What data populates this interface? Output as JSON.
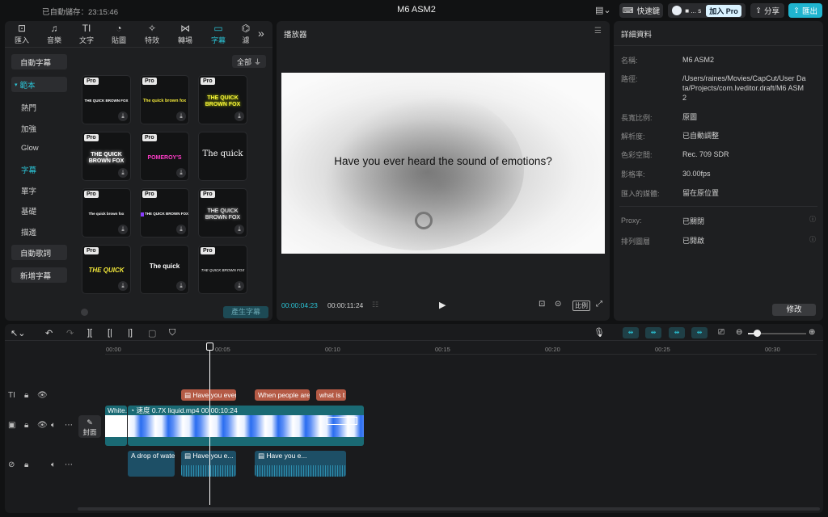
{
  "topbar": {
    "autosave": "已自動儲存：23:15:46",
    "title": "M6 ASM2",
    "shortcuts": "快速鍵",
    "account": "■ ... s",
    "pro": "加入 Pro",
    "share": "分享",
    "export": "匯出"
  },
  "tools": [
    "匯入",
    "音樂",
    "文字",
    "貼圖",
    "特效",
    "轉場",
    "字幕",
    "濾"
  ],
  "left": {
    "auto_caption": "自動字幕",
    "template_section": "範本",
    "items": [
      "熱門",
      "加強",
      "Glow",
      "字幕",
      "單字",
      "基礎",
      "描邊"
    ],
    "auto_lyrics": "自動歌詞",
    "add_caption": "新增字幕",
    "filter_label": "全部",
    "generate": "產生字幕",
    "cards": [
      {
        "text": "THE QUICK BROWN FOX",
        "pro": "Pro"
      },
      {
        "text": "The quick brown fox",
        "pro": "Pro"
      },
      {
        "text": "THE QUICK BROWN FOX",
        "pro": "Pro"
      },
      {
        "text": "THE QUICK BROWN FOX",
        "pro": "Pro"
      },
      {
        "text": "POMEROY'S",
        "pro": "Pro"
      },
      {
        "text": "The quick",
        "pro": ""
      },
      {
        "text": "The quick brown fox",
        "pro": "Pro"
      },
      {
        "text": "THE QUICK BROWN FOX",
        "pro": "Pro"
      },
      {
        "text": "THE QUICK BROWN FOX",
        "pro": "Pro"
      },
      {
        "text": "THE QUICK",
        "pro": "Pro"
      },
      {
        "text": "The quick",
        "pro": ""
      },
      {
        "text": "THE QUICK BROWN FOX",
        "pro": "Pro"
      }
    ]
  },
  "player": {
    "title": "播放器",
    "caption": "Have you ever heard the sound of emotions?",
    "current_time": "00:00:04:23",
    "total_time": "00:00:11:24",
    "ratio": "比例"
  },
  "details": {
    "title": "詳細資料",
    "rows": [
      {
        "label": "名稱:",
        "value": "M6 ASM2"
      },
      {
        "label": "路徑:",
        "value": "/Users/raines/Movies/CapCut/User Data/Projects/com.lveditor.draft/M6 ASM2"
      },
      {
        "label": "長寬比例:",
        "value": "原圖"
      },
      {
        "label": "解析度:",
        "value": "已自動調整"
      },
      {
        "label": "色彩空間:",
        "value": "Rec. 709 SDR"
      },
      {
        "label": "影格率:",
        "value": "30.00fps"
      },
      {
        "label": "匯入的媒體:",
        "value": "留在原位置"
      },
      {
        "label": "Proxy:",
        "value": "已關閉"
      },
      {
        "label": "排列圖層",
        "value": "已開啟"
      }
    ],
    "modify": "修改"
  },
  "timeline": {
    "ticks": [
      "00:00",
      "00:05",
      "00:10",
      "00:15",
      "00:20",
      "00:25",
      "00:30"
    ],
    "text_clips": [
      "Have you ever",
      "When people are",
      "what is t"
    ],
    "video_clip_a": "White.",
    "video_clip_b": "速度 0.7X   liquid.mp4   00:00:10:24",
    "cover": "封面",
    "audio_clips": [
      "A drop of water",
      "Have you e...",
      "Have you e..."
    ]
  },
  "colors": {
    "accent": "#2bc4d6",
    "pro": "#d9f2ff",
    "text_clip": "#b45a45",
    "video_clip": "#1a6a74",
    "audio_clip": "#1d4f66"
  }
}
